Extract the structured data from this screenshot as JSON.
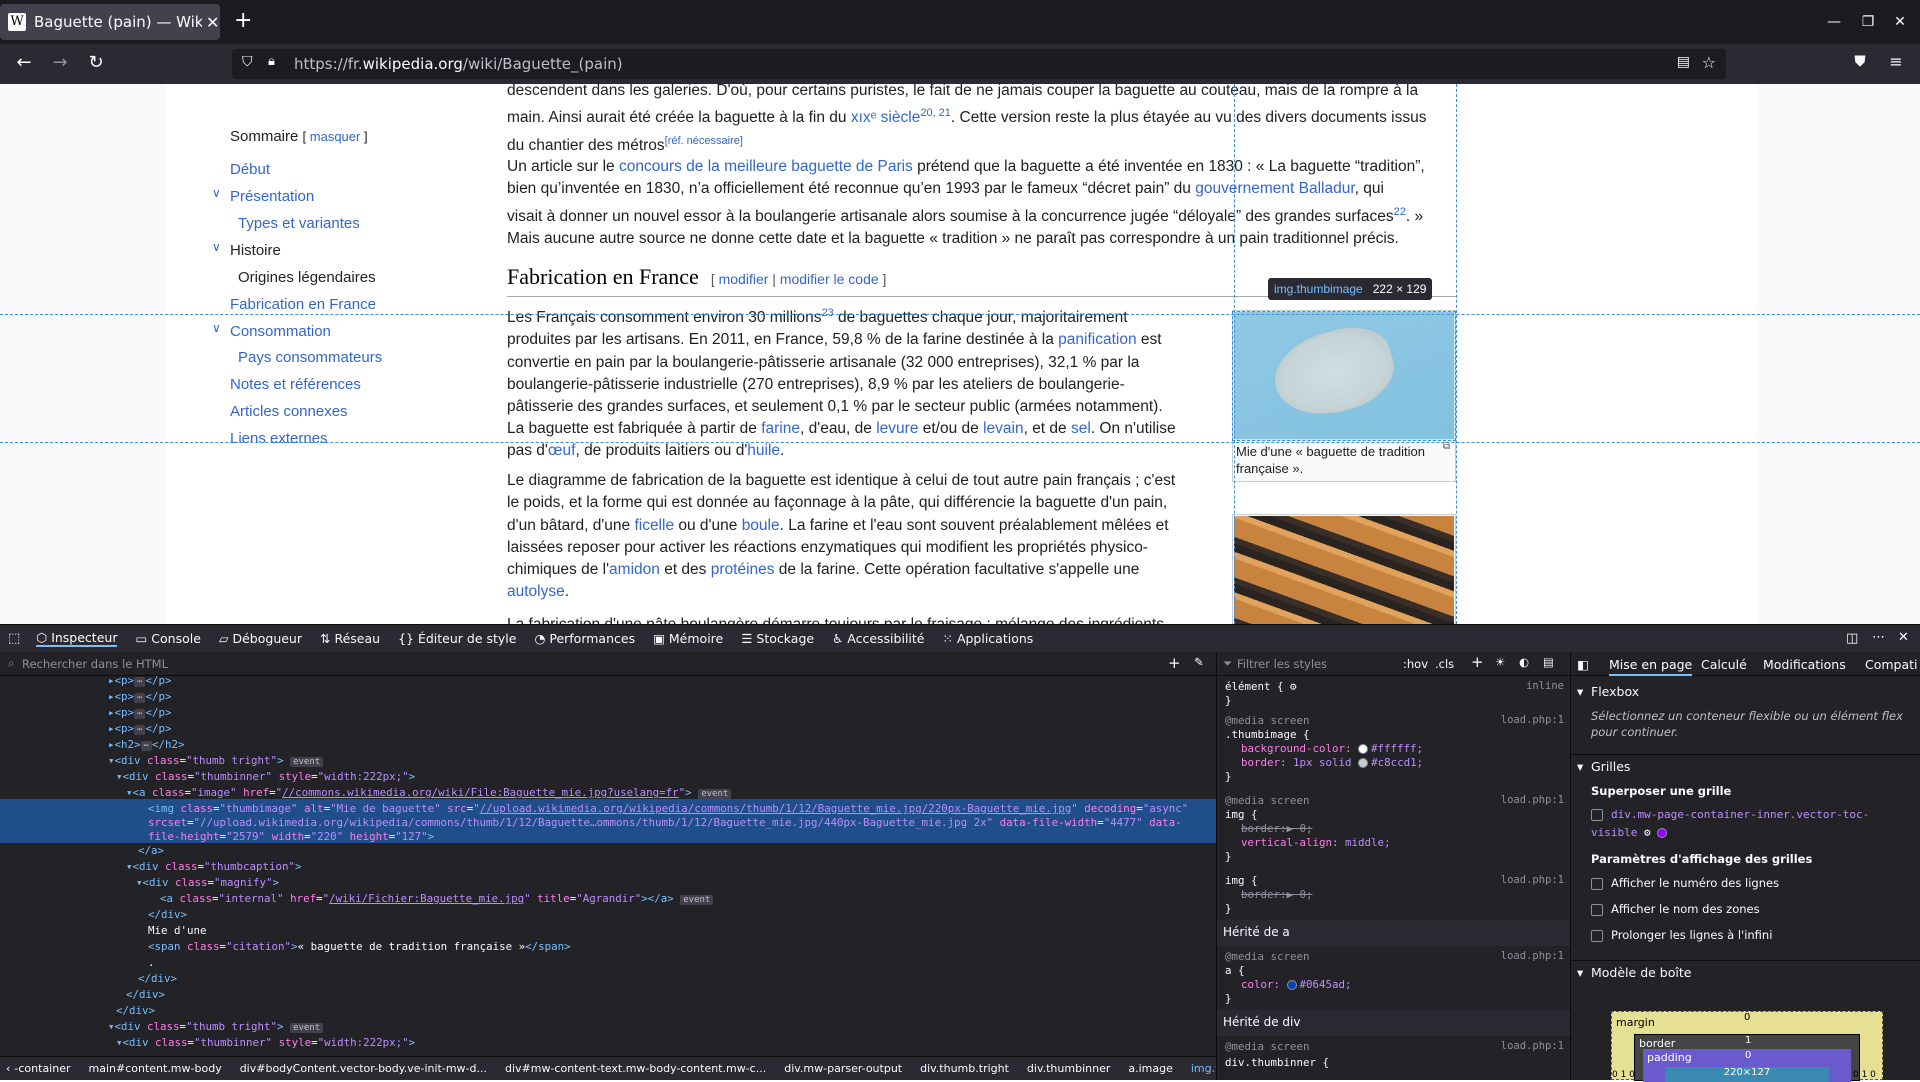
{
  "browser": {
    "tab_title": "Baguette (pain) — Wikipé",
    "favicon": "W",
    "url_prefix": "https://fr.",
    "url_domain": "wikipedia.org",
    "url_path": "/wiki/Baguette_(pain)"
  },
  "toc": {
    "title": "Sommaire",
    "hide": "masquer",
    "items": [
      "Début",
      "Présentation",
      "Types et variantes",
      "Histoire",
      "Origines légendaires",
      "Fabrication en France",
      "Consommation",
      "Pays consommateurs",
      "Notes et références",
      "Articles connexes",
      "Liens externes"
    ]
  },
  "article": {
    "p0a": "descendent dans les galeries. D'où, pour certains puristes, le fait de ne jamais couper la baguette au couteau, mais de la rompre à la",
    "p0b": "main. Ainsi aurait été créée la baguette à la fin du ",
    "p0c": "xıxᵉ siècle",
    "p0d": "20, 21",
    "p0e": ". Cette version reste la plus étayée au vu des divers documents issus",
    "p0f": "du chantier des métros",
    "p0g": "[réf. nécessaire]",
    "p1a": "Un article sur le ",
    "p1b": "concours de la meilleure baguette de Paris",
    "p1c": " prétend que la baguette a été inventée en 1830 : « La baguette “tradition”,",
    "p1d": "bien qu’inventée en 1830, n’a officiellement été reconnue qu’en 1993 par le fameux “décret pain” du ",
    "p1e": "gouvernement Balladur",
    "p1f": ", qui",
    "p1g": "visait à donner un nouvel essor à la boulangerie artisanale alors soumise à la concurrence jugée “déloyale” des grandes surfaces",
    "p1h": "22",
    "p1i": ". »",
    "p1j": "Mais aucune autre source ne donne cette date et la baguette « tradition » ne paraît pas correspondre à un pain traditionnel précis.",
    "h2": "Fabrication en France",
    "edit1": "modifier",
    "edit2": "modifier le code",
    "p2a": "Les Français consomment environ 30 millions",
    "p2b": "23",
    "p2c": " de baguettes chaque jour, majoritairement",
    "p2d": "produites par les artisans. En 2011, en France, 59,8 % de la farine destinée à la ",
    "p2e": "panification",
    "p2f": " est",
    "p2g": "convertie en pain par la boulangerie-pâtisserie artisanale (32 000 entreprises), 32,1 % par la",
    "p2h": "boulangerie-pâtisserie industrielle (270 entreprises), 8,9 % par les ateliers de boulangerie-",
    "p2i": "pâtisserie des grandes surfaces, et seulement 0,1 % par le secteur public (armées notamment).",
    "p3a": "La baguette est fabriquée à partir de ",
    "p3b": "farine",
    "p3c": ", d'eau, de ",
    "p3d": "levure",
    "p3e": " et/ou de ",
    "p3f": "levain",
    "p3g": ", et de ",
    "p3h": "sel",
    "p3i": ". On n'utilise",
    "p3j": "pas d'",
    "p3k": "œuf",
    "p3l": ", de produits laitiers ou d'",
    "p3m": "huile",
    "p3n": ".",
    "p4a": "Le diagramme de fabrication de la baguette est identique à celui de tout autre pain français ; c'est",
    "p4b": "le poids, et la forme qui est donnée au façonnage à la pâte, qui différencie la baguette d'un pain,",
    "p4c": "d'un bâtard, d'une ",
    "p4d": "ficelle",
    "p4e": " ou d'une ",
    "p4f": "boule",
    "p4g": ". La farine et l'eau sont souvent préalablement mêlées et",
    "p4h": "laissées reposer pour activer les réactions enzymatiques qui modifient les propriétés physico-",
    "p4i": "chimiques de l'",
    "p4j": "amidon",
    "p4k": " et des ",
    "p4l": "protéines",
    "p4m": " de la farine. Cette opération facultative s'appelle une",
    "p4n": "autolyse",
    "p4o": ".",
    "p5": "La fabrication d'une pâte boulangère démarre toujours par le fraisage : mélange des ingrédients",
    "caption": "Mie d'une « baguette de tradition française »."
  },
  "tooltip": {
    "cls": "img.thumbimage",
    "size": "222 × 129"
  },
  "devtools": {
    "tabs": [
      "Inspecteur",
      "Console",
      "Débogueur",
      "Réseau",
      "Éditeur de style",
      "Performances",
      "Mémoire",
      "Stockage",
      "Accessibilité",
      "Applications"
    ],
    "search_placeholder": "Rechercher dans le HTML",
    "filter_placeholder": "Filtrer les styles",
    "hov": ":hov",
    "cls": ".cls",
    "breadcrumbs": [
      "-container",
      "main#content.mw-body",
      "div#bodyContent.vector-body.ve-init-mw-d...",
      "div#mw-content-text.mw-body-content.mw-c...",
      "div.mw-parser-output",
      "div.thumb.tright",
      "div.thumbinner",
      "a.image",
      "img.thumbimage"
    ],
    "layout_tabs": [
      "Mise en page",
      "Calculé",
      "Modifications",
      "Compati"
    ],
    "flexbox_title": "Flexbox",
    "flexbox_hint": "Sélectionnez un conteneur flexible ou un élément flex pour continuer.",
    "grids_title": "Grilles",
    "overlay_title": "Superposer une grille",
    "grid_item": "div.mw-page-container-inner.vector-toc-visible",
    "grid_params_title": "Paramètres d'affichage des grilles",
    "grid_opts": [
      "Afficher le numéro des lignes",
      "Afficher le nom des zones",
      "Prolonger les lignes à l'infini"
    ],
    "boxmodel_title": "Modèle de boîte",
    "box": {
      "margin": "margin",
      "border": "border",
      "padding": "padding",
      "m0": "0",
      "b1": "1",
      "p0": "0",
      "size": "220×127",
      "sides": "0 1 0",
      "sides2": "0 1 0"
    },
    "rules": {
      "element": "élément {",
      "inline": "inline",
      "media": "@media screen",
      "src": "load.php:1",
      "sel1": ".thumbimage {",
      "bgprop": "background-color:",
      "bgval": "#ffffff;",
      "bprop": "border:",
      "bval": "1px solid",
      "bcol": "#c8ccd1;",
      "sel2": "img {",
      "border0": "border:▶ 0;",
      "vaprop": "vertical-align:",
      "vaval": "middle;",
      "inh_a": "Hérité de a",
      "sel_a": "a {",
      "colprop": "color:",
      "colval": "#0645ad;",
      "inh_div": "Hérité de div",
      "sel_div": "div.thumbinner {",
      "close": "}"
    }
  },
  "colors": {
    "link": "#3366cc",
    "selection": "#204e8a",
    "guide": "#3a8fd8"
  }
}
